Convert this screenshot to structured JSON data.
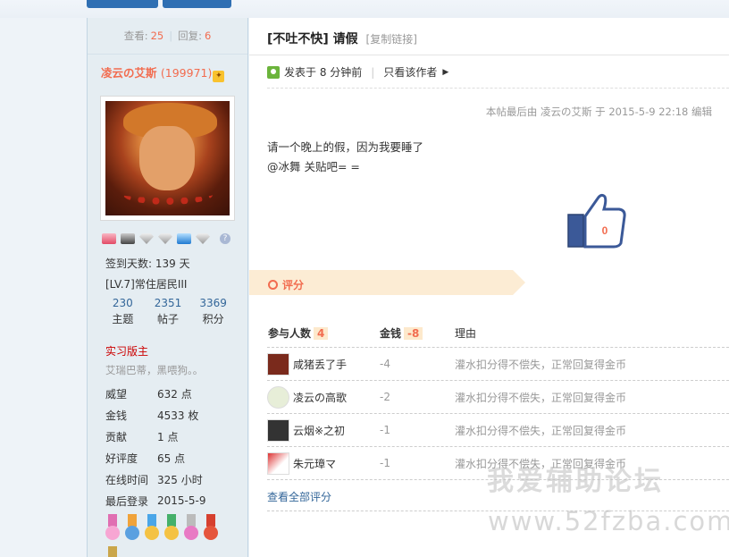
{
  "thread": {
    "views_label": "查看:",
    "views": "25",
    "replies_label": "回复:",
    "replies": "6",
    "category": "[不吐不快]",
    "title": "请假",
    "copy_link": "[复制链接]"
  },
  "author": {
    "name": "凌云の艾斯",
    "uid": "(199971)",
    "badge_icon": "vip-badge-icon",
    "sign_days": "签到天数: 139 天",
    "level": "[LV.7]常住居民III",
    "counters": [
      {
        "value": "230",
        "label": "主题"
      },
      {
        "value": "2351",
        "label": "帖子"
      },
      {
        "value": "3369",
        "label": "积分"
      }
    ],
    "role": "实习版主",
    "signature": "艾瑞巴蒂，黑喂狗。。",
    "info": [
      {
        "key": "威望",
        "value": "632 点"
      },
      {
        "key": "金钱",
        "value": "4533 枚"
      },
      {
        "key": "贡献",
        "value": "1 点"
      },
      {
        "key": "好评度",
        "value": "65 点"
      },
      {
        "key": "在线时间",
        "value": "325 小时"
      },
      {
        "key": "最后登录",
        "value": "2015-5-9"
      }
    ]
  },
  "post": {
    "posted": "发表于 8 分钟前",
    "only_author": "只看该作者",
    "edited": "本帖最后由 凌云の艾斯 于 2015-5-9 22:18 编辑",
    "line1": "请一个晚上的假，因为我要睡了",
    "line2": "@冰舞 关贴吧= =",
    "like_count": "0"
  },
  "rating": {
    "label": "评分",
    "col_people": "参与人数",
    "people_count": "4",
    "col_money": "金钱",
    "money_total": "-8",
    "col_reason": "理由",
    "rows": [
      {
        "name": "咸猪丢了手",
        "money": "-4",
        "reason": "灌水扣分得不偿失，正常回复得金币"
      },
      {
        "name": "凌云の高歌",
        "money": "-2",
        "reason": "灌水扣分得不偿失，正常回复得金币"
      },
      {
        "name": "云烟※之初",
        "money": "-1",
        "reason": "灌水扣分得不偿失，正常回复得金币"
      },
      {
        "name": "朱元璋マ",
        "money": "-1",
        "reason": "灌水扣分得不偿失，正常回复得金币"
      }
    ],
    "view_all": "查看全部评分"
  },
  "watermark": {
    "line1": "我爱辅助论坛",
    "line2": "www.52fzba.com"
  },
  "colors": {
    "accent": "#f26c4f",
    "link": "#336699",
    "sidebar_bg": "#e5edf2"
  }
}
